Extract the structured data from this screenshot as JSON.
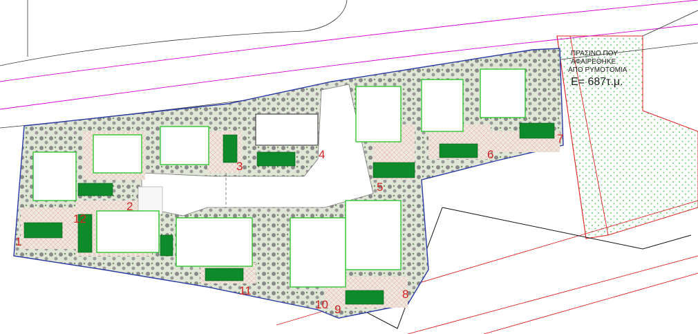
{
  "note": {
    "line1": "ΠΡΑΣΙΝΟ ΠΟΥ",
    "line2": "ΑΦΑΙΡΕΘΗΚΕ",
    "line3": "ΑΠΟ ΡΥΜΟΤΟΜΙΑ",
    "area": "E= 687τ.μ."
  },
  "lots": [
    {
      "id": "lot-1",
      "label": "1"
    },
    {
      "id": "lot-2",
      "label": "2"
    },
    {
      "id": "lot-3",
      "label": "3"
    },
    {
      "id": "lot-4",
      "label": "4"
    },
    {
      "id": "lot-5",
      "label": "5"
    },
    {
      "id": "lot-6",
      "label": "6"
    },
    {
      "id": "lot-7",
      "label": "7"
    },
    {
      "id": "lot-8",
      "label": "8"
    },
    {
      "id": "lot-9",
      "label": "9"
    },
    {
      "id": "lot-10",
      "label": "10"
    },
    {
      "id": "lot-11",
      "label": "11"
    },
    {
      "id": "lot-12",
      "label": "12"
    }
  ],
  "colors": {
    "road_line": "#d400d4",
    "boundary": "#2a3aa8",
    "building": "#22c422",
    "lot_number": "#d42020",
    "green_area_dots": "#7fd37f",
    "pool": "#0d8a2a",
    "plot_line": "#e02020"
  }
}
